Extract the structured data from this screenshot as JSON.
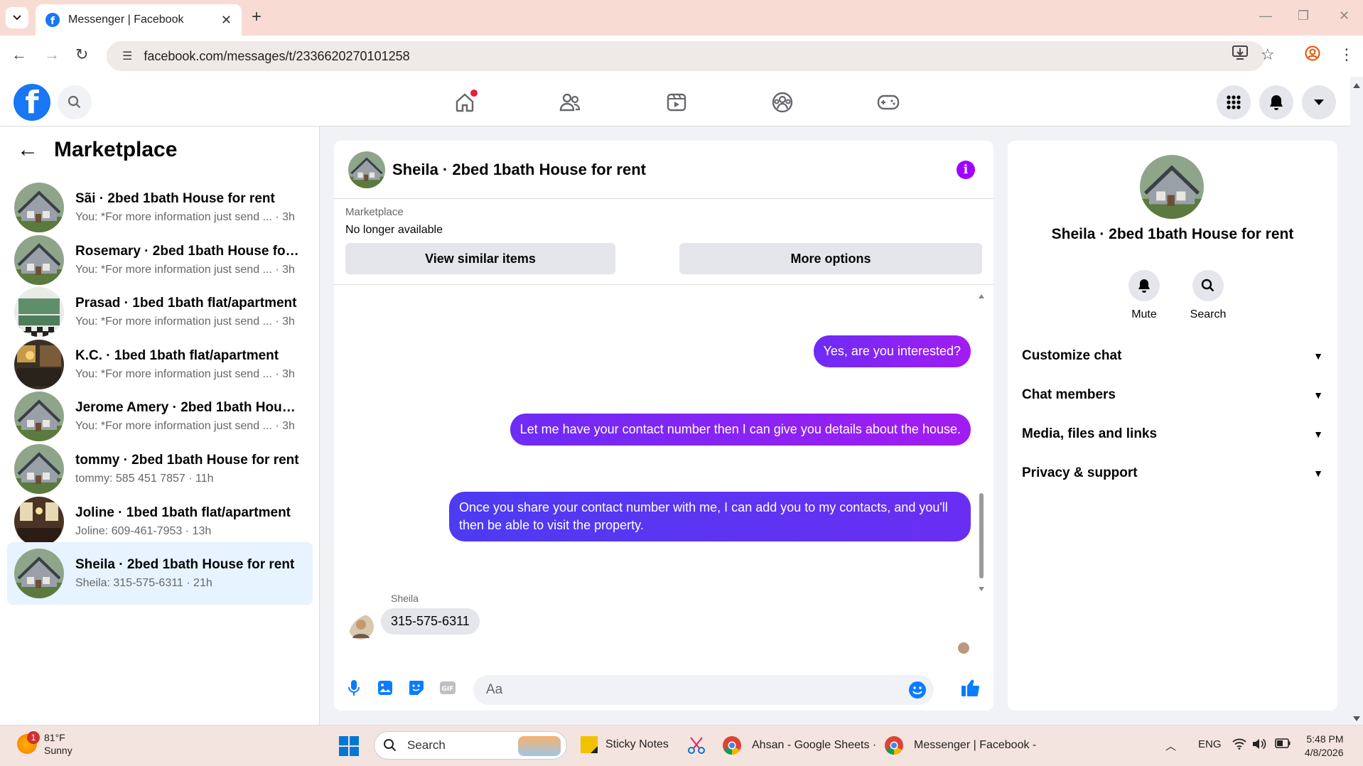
{
  "browser": {
    "tab_title": "Messenger | Facebook",
    "url": "facebook.com/messages/t/2336620270101258"
  },
  "sidebar": {
    "title": "Marketplace",
    "conversations": [
      {
        "name": "Sãi · 2bed 1bath House for rent",
        "preview": "You: *For more information just send ...",
        "time": "· 3h",
        "thumb": "house"
      },
      {
        "name": "Rosemary · 2bed 1bath House for r...",
        "preview": "You: *For more information just send ...",
        "time": "· 3h",
        "thumb": "house"
      },
      {
        "name": "Prasad · 1bed 1bath flat/apartment",
        "preview": "You: *For more information just send ...",
        "time": "· 3h",
        "thumb": "kitchen-green"
      },
      {
        "name": "K.C. · 1bed 1bath flat/apartment",
        "preview": "You: *For more information just send ...",
        "time": "· 3h",
        "thumb": "kitchen-dark"
      },
      {
        "name": "Jerome Amery · 2bed 1bath House...",
        "preview": "You: *For more information just send ...",
        "time": "· 3h",
        "thumb": "house"
      },
      {
        "name": "tommy · 2bed 1bath House for rent",
        "preview": "tommy: 585 451 7857",
        "time": "· 11h",
        "thumb": "house"
      },
      {
        "name": "Joline · 1bed 1bath flat/apartment",
        "preview": "Joline: 609-461-7953",
        "time": "· 13h",
        "thumb": "living-room"
      },
      {
        "name": "Sheila · 2bed 1bath House for rent",
        "preview": "Sheila: 315-575-6311",
        "time": "· 21h",
        "thumb": "house"
      }
    ]
  },
  "chat": {
    "title": "Sheila · 2bed 1bath House for rent",
    "marketplace_label": "Marketplace",
    "status": "No longer available",
    "view_similar": "View similar items",
    "more_options": "More options",
    "messages_out": [
      "Yes, are you interested?",
      "Let me have your contact number then I can give you details about the house.",
      "Once you share your contact number with me, I can add you to my contacts, and you'll then be able to visit the property."
    ],
    "sender_name": "Sheila",
    "message_in": "315-575-6311",
    "composer_placeholder": "Aa"
  },
  "details": {
    "title": "Sheila · 2bed 1bath House for rent",
    "mute_label": "Mute",
    "search_label": "Search",
    "sections": [
      "Customize chat",
      "Chat members",
      "Media, files and links",
      "Privacy & support"
    ]
  },
  "taskbar": {
    "weather_badge": "1",
    "temperature": "81°F",
    "condition": "Sunny",
    "search_label": "Search",
    "apps": [
      "Sticky Notes",
      "Ahsan - Google Sheets ·",
      "Messenger | Facebook -"
    ],
    "language": "ENG",
    "time": "5:48 PM",
    "date": "4/8/2026"
  },
  "colors": {
    "fb_blue": "#1877f2",
    "bubble_purple": "#8a24f3",
    "bubble_indigo": "#4d3bf2",
    "active_item": "#e7f3ff"
  }
}
